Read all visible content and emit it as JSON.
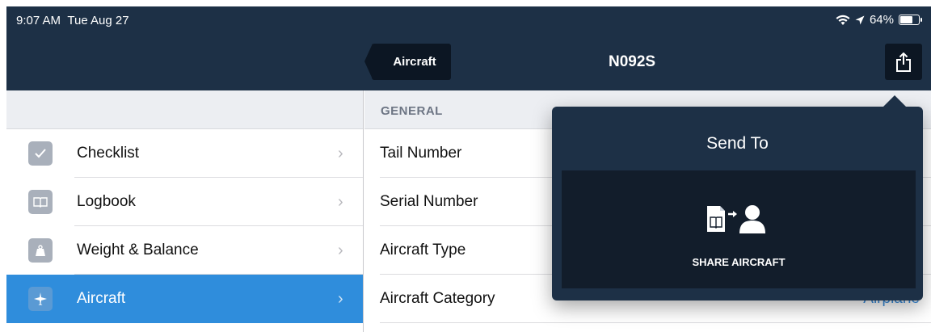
{
  "status_bar": {
    "time": "9:07 AM",
    "date": "Tue Aug 27",
    "battery": "64%",
    "battery_level": 0.64
  },
  "nav": {
    "back_label": "Aircraft",
    "title": "N092S",
    "share_icon": "share-icon"
  },
  "sidebar": {
    "items": [
      {
        "label": "Checklist",
        "icon": "checkmark-icon"
      },
      {
        "label": "Logbook",
        "icon": "book-icon"
      },
      {
        "label": "Weight & Balance",
        "icon": "weight-icon"
      },
      {
        "label": "Aircraft",
        "icon": "airplane-icon",
        "active": true
      }
    ]
  },
  "detail": {
    "section": "GENERAL",
    "rows": [
      {
        "label": "Tail Number",
        "value": ""
      },
      {
        "label": "Serial Number",
        "value": ""
      },
      {
        "label": "Aircraft Type",
        "value": ""
      },
      {
        "label": "Aircraft Category",
        "value": "Airplane"
      }
    ]
  },
  "popover": {
    "title": "Send To",
    "option_label": "SHARE AIRCRAFT",
    "option_icon": "share-aircraft-icon"
  },
  "colors": {
    "nav_bg": "#1d3046",
    "accent": "#2f8ddc",
    "value_text": "#3a8ddc"
  }
}
